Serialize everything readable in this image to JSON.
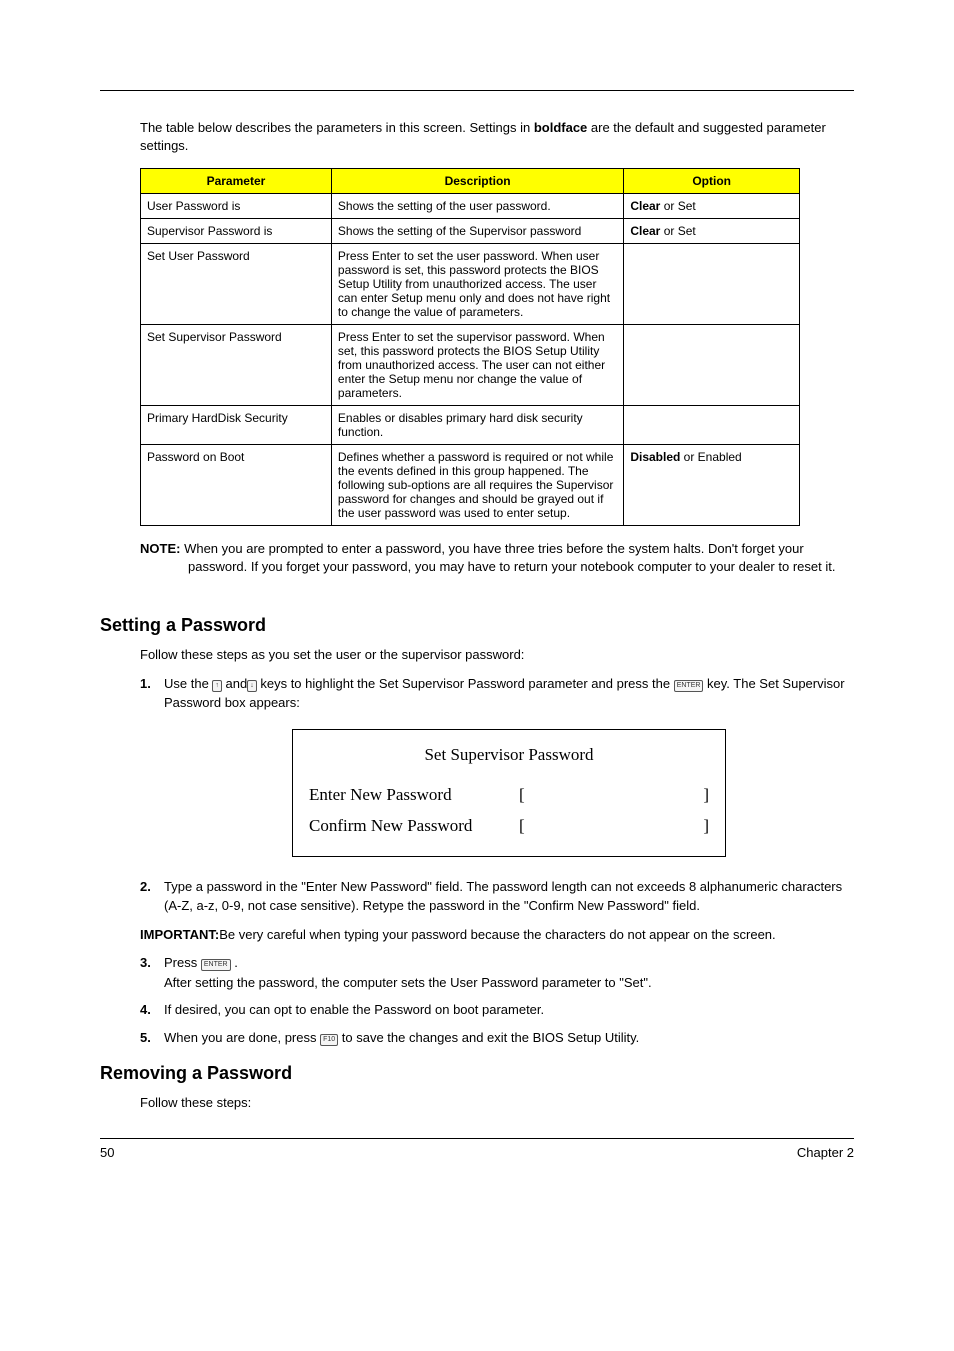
{
  "intro_para_pre": "The table below describes the parameters in this screen. Settings in ",
  "intro_para_bold": "boldface",
  "intro_para_post": " are the default and suggested parameter settings.",
  "table": {
    "headers": [
      "Parameter",
      "Description",
      "Option"
    ],
    "rows": [
      {
        "param": "User Password is",
        "desc": "Shows the setting of the user password.",
        "opt_bold": "Clear",
        "opt_rest": " or Set"
      },
      {
        "param": "Supervisor Password is",
        "desc": "Shows the setting of the Supervisor password",
        "opt_bold": "Clear",
        "opt_rest": " or Set"
      },
      {
        "param": "Set User Password",
        "desc": "Press Enter to set the user password. When user password is set, this password protects the BIOS Setup Utility from unauthorized access. The user can enter Setup menu only and does not have right to change the value of parameters.",
        "opt_bold": "",
        "opt_rest": ""
      },
      {
        "param": "Set Supervisor Password",
        "desc": "Press Enter to set the supervisor password. When set, this password protects the BIOS Setup Utility from unauthorized access. The user can not either enter the Setup menu nor change the value of parameters.",
        "opt_bold": "",
        "opt_rest": ""
      },
      {
        "param": "Primary HardDisk Security",
        "desc": "Enables or disables primary hard disk security function.",
        "opt_bold": "",
        "opt_rest": ""
      },
      {
        "param": "Password on Boot",
        "desc": "Defines whether a password is required or not while the events defined in this group happened. The following sub-options are all requires the Supervisor password for changes and should be grayed out if the user password was used to enter setup.",
        "opt_bold": "Disabled",
        "opt_rest": " or Enabled"
      }
    ]
  },
  "note": {
    "label": "NOTE:",
    "text": " When you are prompted to enter a password, you have three tries before the system halts. Don't forget your password. If you forget your password, you may have to return your notebook computer to your dealer to reset it."
  },
  "setting_pw": {
    "heading": "Setting a Password",
    "intro": "Follow these steps as you set the user or the supervisor password:",
    "step1_a": "Use the ",
    "step1_b": " and",
    "step1_c": " keys to highlight the Set Supervisor Password parameter and press the ",
    "step1_d": " key. The Set Supervisor Password box appears:",
    "bios_title": "Set Supervisor Password",
    "bios_row1": "Enter New Password",
    "bios_row2": "Confirm New Password",
    "step2": "Type a password in the \"Enter New Password\" field. The password length can not exceeds 8 alphanumeric characters (A-Z, a-z, 0-9, not case sensitive). Retype the password in the \"Confirm New Password\" field.",
    "important_label": "IMPORTANT:",
    "important_text": "Be very careful when typing your password because the characters do not appear on the screen.",
    "step3_a": "Press ",
    "step3_b": " .",
    "step3_line2": "After setting the password, the computer sets the User Password parameter to \"Set\".",
    "step4": "If desired, you can opt to enable the Password on boot parameter.",
    "step5_a": "When you are done, press ",
    "step5_b": " to save the changes and exit the BIOS Setup Utility."
  },
  "removing_pw": {
    "heading": "Removing a Password",
    "intro": "Follow these steps:"
  },
  "key_labels": {
    "up": "↑",
    "down": "↓",
    "enter": "ENTER",
    "f10": "F10"
  },
  "footer": {
    "page": "50",
    "chapter": "Chapter 2"
  }
}
